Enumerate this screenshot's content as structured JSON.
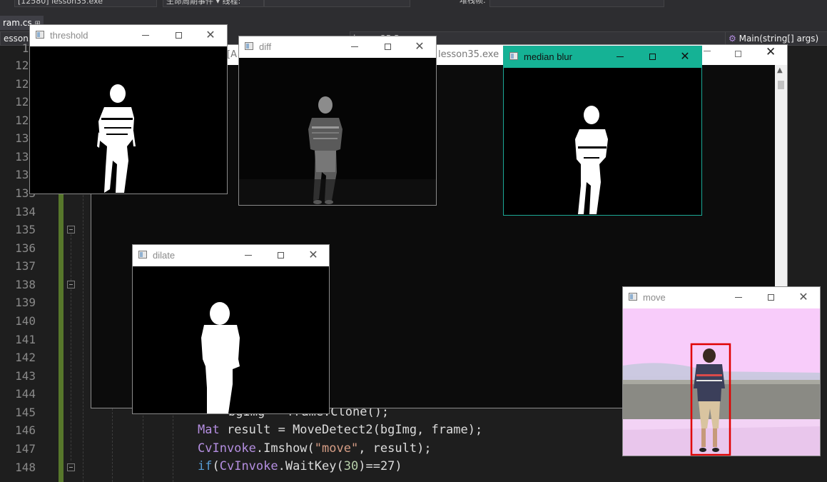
{
  "vs": {
    "toolbar_process": "[12580] lesson35.exe",
    "toolbar_lifecycle": "生命周期事件 ▾ 线程:",
    "toolbar_stack": "堆栈帧:",
    "open_tab": "ram.cs",
    "nav_left": "esson35",
    "nav_middle": "lesson35.Program",
    "nav_method": "Main(string[] args)"
  },
  "editor": {
    "line_numbers": [
      "12",
      "128",
      "129",
      "128",
      "129",
      "130",
      "131",
      "132",
      "133",
      "134",
      "135",
      "136",
      "137",
      "138",
      "139",
      "140",
      "141",
      "142",
      "143",
      "144",
      "145",
      "146",
      "147",
      "148"
    ],
    "code_lines": [
      {
        "line": "145",
        "text": "bgImg = frame.Clone();"
      },
      {
        "line": "146",
        "type": "Mat",
        "rest": " result = MoveDetect2(bgImg, frame);"
      },
      {
        "line": "147",
        "type": "CvInvoke",
        "rest_a": ".Imshow(",
        "str": "\"move\"",
        "rest_b": ", result);"
      },
      {
        "line": "148",
        "kw": "if",
        "rest_a": "(",
        "type": "CvInvoke",
        "rest_b": ".WaitKey(",
        "num": "30",
        "rest_c": ")==27)"
      }
    ]
  },
  "console": {
    "title_partial": "[A",
    "title_exe": "lesson35.exe"
  },
  "windows": {
    "threshold": {
      "title": "threshold"
    },
    "diff": {
      "title": "diff"
    },
    "median_blur": {
      "title": "median blur"
    },
    "dilate": {
      "title": "dilate"
    },
    "move": {
      "title": "move"
    }
  },
  "colors": {
    "active_titlebar": "#15b295",
    "bounding_box": "#e00000"
  }
}
